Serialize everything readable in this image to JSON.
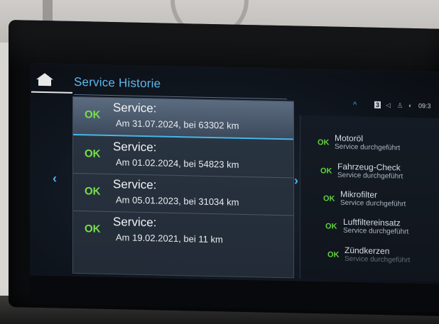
{
  "header": {
    "title": "Service Historie"
  },
  "status": {
    "up_arrow": "^",
    "badge": "3",
    "time": "09:3"
  },
  "service_list": [
    {
      "status": "OK",
      "title": "Service:",
      "detail": "Am 31.07.2024, bei 63302 km",
      "selected": true
    },
    {
      "status": "OK",
      "title": "Service:",
      "detail": "Am 01.02.2024, bei 54823 km",
      "selected": false
    },
    {
      "status": "OK",
      "title": "Service:",
      "detail": "Am 05.01.2023, bei 31034 km",
      "selected": false
    },
    {
      "status": "OK",
      "title": "Service:",
      "detail": "Am 19.02.2021, bei 11 km",
      "selected": false
    }
  ],
  "detail_items": [
    {
      "status": "OK",
      "title": "Motoröl",
      "subtitle": "Service durchgeführt"
    },
    {
      "status": "OK",
      "title": "Fahrzeug-Check",
      "subtitle": "Service durchgeführt"
    },
    {
      "status": "OK",
      "title": "Mikrofilter",
      "subtitle": "Service durchgeführt"
    },
    {
      "status": "OK",
      "title": "Luftfiltereinsatz",
      "subtitle": "Service durchgeführt"
    },
    {
      "status": "OK",
      "title": "Zündkerzen",
      "subtitle": "Service durchgeführt"
    }
  ],
  "nav": {
    "left_glyph": "‹",
    "right_glyph": "›"
  },
  "colors": {
    "accent_blue": "#49b6ee",
    "ok_green": "#76e04a"
  }
}
